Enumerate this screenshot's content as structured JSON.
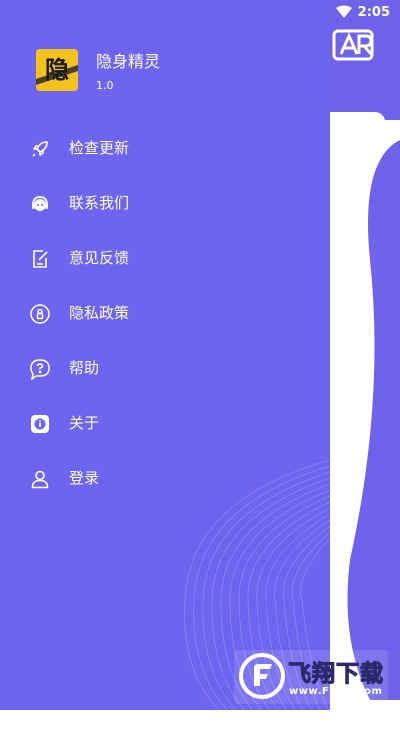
{
  "status_bar": {
    "time": "2:05",
    "icons": [
      "wifi-icon",
      "battery-icon"
    ]
  },
  "app": {
    "name": "隐身精灵",
    "version": "1.0",
    "logo_text": "隐"
  },
  "menu": [
    {
      "label": "检查更新",
      "icon": "rocket-icon"
    },
    {
      "label": "联系我们",
      "icon": "customer-service-icon"
    },
    {
      "label": "意见反馈",
      "icon": "feedback-icon"
    },
    {
      "label": "隐私政策",
      "icon": "privacy-icon"
    },
    {
      "label": "帮助",
      "icon": "help-icon"
    },
    {
      "label": "关于",
      "icon": "about-icon"
    },
    {
      "label": "登录",
      "icon": "user-icon"
    }
  ],
  "watermark": {
    "title": "飞翔下载",
    "url": "www.FXXZ.com"
  },
  "colors": {
    "drawer": "#6d64ef",
    "header": "#6e63ea",
    "logo": "#f4c31b",
    "text": "#ffffff"
  }
}
